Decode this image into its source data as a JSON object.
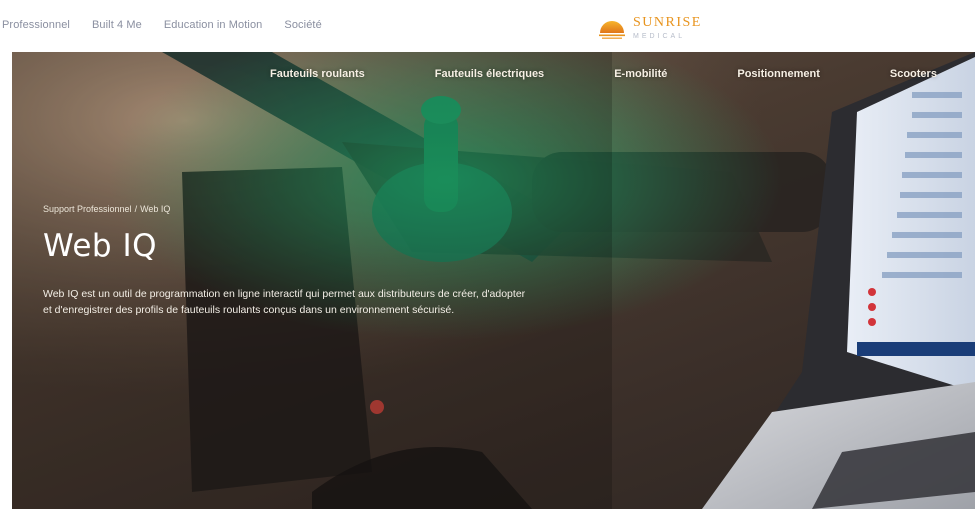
{
  "topbar": {
    "links": [
      "Professionnel",
      "Built 4 Me",
      "Education in Motion",
      "Société"
    ]
  },
  "logo": {
    "main": "SUNRISE",
    "sub": "MEDICAL",
    "color": "#e8941e"
  },
  "mainnav": {
    "items": [
      "Fauteuils roulants",
      "Fauteuils électriques",
      "E-mobilité",
      "Positionnement",
      "Scooters"
    ]
  },
  "breadcrumb": {
    "parent": "Support Professionnel",
    "separator": "/",
    "current": "Web IQ"
  },
  "hero": {
    "title": "Web IQ",
    "description": "Web IQ est un outil de programmation en ligne interactif qui permet aux distributeurs de créer, d'adopter et d'enregistrer des profils de fauteuils roulants conçus dans un environnement sécurisé."
  },
  "colors": {
    "accent": "#e8941e",
    "toplink": "#8a8fa0",
    "nav_text": "#f6efe4",
    "joystick_green": "#1fae6a"
  },
  "icons": [
    "sunrise-logo-icon"
  ]
}
